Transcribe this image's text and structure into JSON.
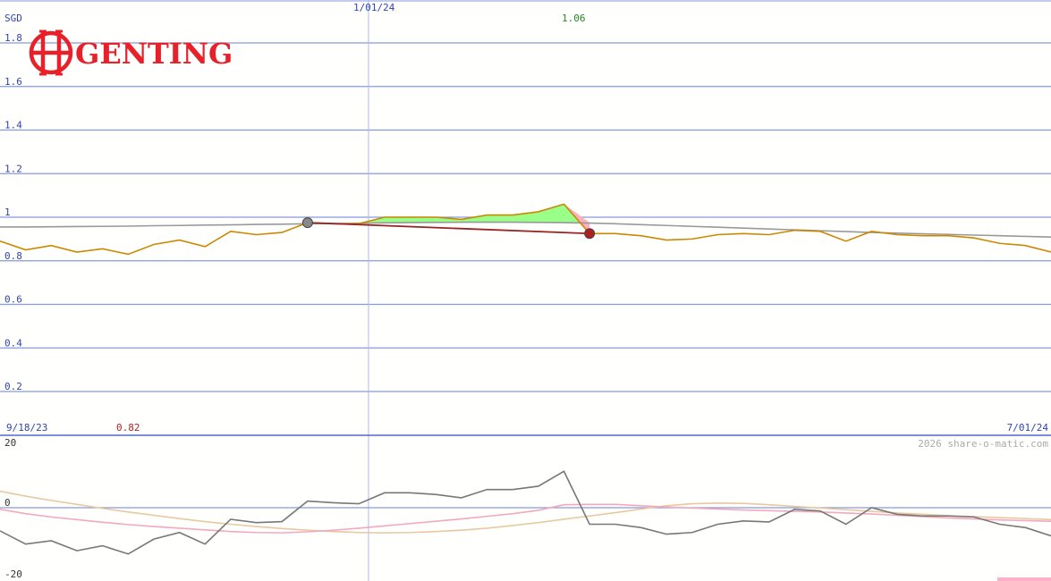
{
  "chart_data": [
    {
      "type": "line",
      "panel": "price",
      "currency_label": "SGD",
      "y_ticks": [
        "1.8",
        "1.6",
        "1.4",
        "1.2",
        "1",
        "0.8",
        "0.6",
        "0.4",
        "0.2"
      ],
      "ylim": [
        0,
        1.9
      ],
      "start_date": "9/18/23",
      "marker_date": "1/01/24",
      "end_date": "7/01/24",
      "low_label": "0.82",
      "high_label": "1.06",
      "grid": true,
      "series": [
        {
          "color": "#cc8800",
          "values": [
            0.89,
            0.85,
            0.87,
            0.84,
            0.855,
            0.83,
            0.875,
            0.895,
            0.865,
            0.935,
            0.92,
            0.93,
            0.975,
            0.97,
            0.97,
            1.0,
            1.0,
            1.0,
            0.99,
            1.01,
            1.01,
            1.025,
            1.06,
            0.925,
            0.925,
            0.915,
            0.895,
            0.9,
            0.92,
            0.925,
            0.92,
            0.94,
            0.935,
            0.89,
            0.935,
            0.92,
            0.915,
            0.915,
            0.905,
            0.88,
            0.87,
            0.84
          ]
        },
        {
          "color": "#999999",
          "values": [
            0.955,
            0.955,
            0.956,
            0.957,
            0.958,
            0.959,
            0.961,
            0.962,
            0.964,
            0.965,
            0.967,
            0.968,
            0.97,
            0.971,
            0.972,
            0.974,
            0.975,
            0.976,
            0.977,
            0.977,
            0.977,
            0.976,
            0.975,
            0.973,
            0.97,
            0.966,
            0.962,
            0.958,
            0.954,
            0.95,
            0.946,
            0.942,
            0.938,
            0.934,
            0.93,
            0.927,
            0.924,
            0.921,
            0.918,
            0.915,
            0.912,
            0.909
          ]
        }
      ],
      "trade_markers": [
        {
          "index": 12,
          "value": 0.975,
          "color": "#888888"
        },
        {
          "index": 23,
          "value": 0.925,
          "color": "#aa2222"
        }
      ]
    },
    {
      "type": "line",
      "panel": "oscillator",
      "y_ticks": [
        "20",
        "0",
        "-20"
      ],
      "ylim": [
        -22,
        22
      ],
      "series": [
        {
          "color": "#777777",
          "values": [
            -7,
            -11,
            -10,
            -13,
            -11.5,
            -14,
            -9.5,
            -7.5,
            -11,
            -3.5,
            -4.5,
            -4.2,
            2,
            1.5,
            1.2,
            4.5,
            4.5,
            4,
            3,
            5.5,
            5.5,
            6.5,
            11,
            -5,
            -5,
            -6,
            -8,
            -7.5,
            -5,
            -4,
            -4.3,
            -0.5,
            -1,
            -5,
            0,
            -2,
            -2.5,
            -2.5,
            -2.8,
            -5,
            -6,
            -8.5
          ]
        },
        {
          "color": "#f4a8c0",
          "values": [
            -0.5,
            -1.8,
            -2.8,
            -3.6,
            -4.4,
            -5.1,
            -5.7,
            -6.2,
            -6.7,
            -7.2,
            -7.5,
            -7.6,
            -7.3,
            -6.8,
            -6.2,
            -5.5,
            -4.8,
            -4.1,
            -3.4,
            -2.6,
            -1.8,
            -0.8,
            0.9,
            1.0,
            1.0,
            0.6,
            0.2,
            -0.1,
            -0.4,
            -0.7,
            -0.9,
            -1.1,
            -1.3,
            -1.6,
            -1.9,
            -2.3,
            -2.7,
            -3.1,
            -3.4,
            -3.7,
            -3.9,
            -4.1
          ]
        },
        {
          "color": "#e8c8a0",
          "values": [
            5,
            3.5,
            2.2,
            1,
            -0.2,
            -1.3,
            -2.3,
            -3.3,
            -4.2,
            -5.0,
            -5.7,
            -6.3,
            -6.8,
            -7.2,
            -7.5,
            -7.6,
            -7.5,
            -7.2,
            -6.8,
            -6.2,
            -5.4,
            -4.5,
            -3.5,
            -2.5,
            -1.5,
            -0.4,
            0.6,
            1.2,
            1.4,
            1.3,
            0.9,
            0.4,
            -0.1,
            -0.6,
            -1.1,
            -1.6,
            -2.0,
            -2.4,
            -2.7,
            -3.0,
            -3.3,
            -3.6
          ]
        }
      ]
    }
  ],
  "logo": {
    "text": "GENTING",
    "color": "#e8202a"
  },
  "watermark": "2026 share-o-matic.com",
  "colors": {
    "grid": "#8899dd",
    "axis_text": "#3344aa",
    "high_text": "#228822",
    "low_text": "#aa2222",
    "gain_fill": "#99ff88",
    "loss_fill": "#ffb0c0",
    "trade_line": "#992222"
  }
}
